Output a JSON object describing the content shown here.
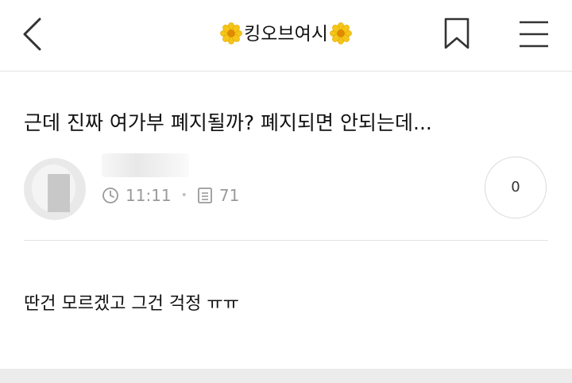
{
  "header": {
    "title": "킹오브여시",
    "left_icon": "flower-icon",
    "right_icon": "flower-icon",
    "back_icon": "chevron-left-icon",
    "bookmark_icon": "bookmark-icon",
    "menu_icon": "hamburger-menu-icon"
  },
  "post": {
    "title": "근데 진짜 여가부 폐지될까? 폐지되면 안되는데...",
    "time": "11:11",
    "views": "71",
    "comment_count": "0",
    "body": "딴건 모르겠고 그건 걱정 ㅠㅠ"
  },
  "colors": {
    "flower_petal": "#f5c518",
    "flower_center": "#e08a00",
    "meta_gray": "#9a9a9a"
  }
}
